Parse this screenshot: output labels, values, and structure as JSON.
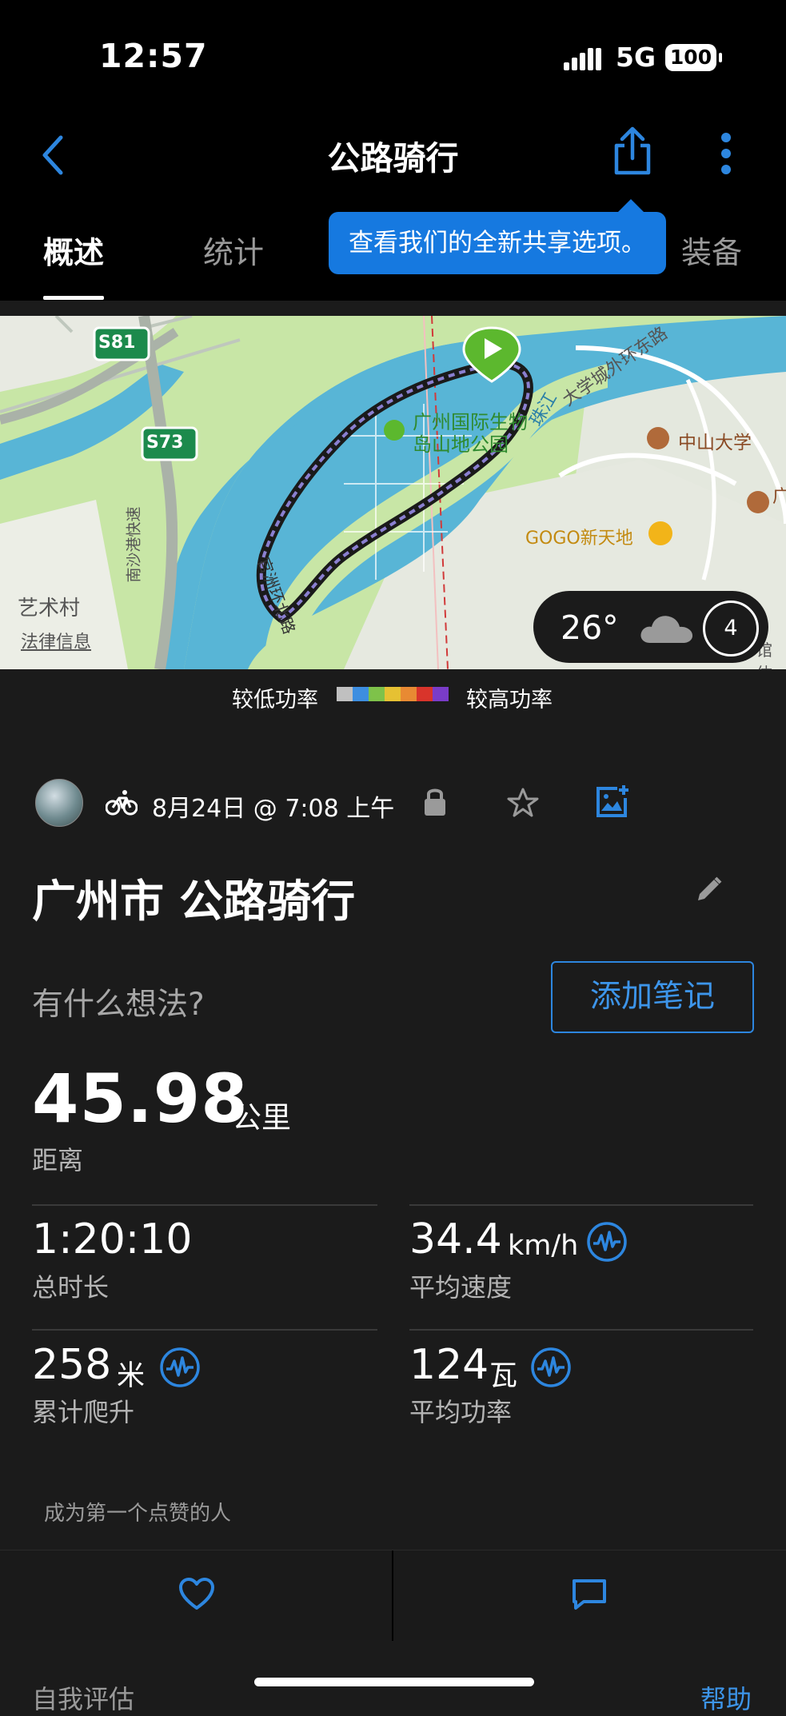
{
  "status_bar": {
    "time": "12:57",
    "network": "5G",
    "battery": "100"
  },
  "header": {
    "title": "公路骑行"
  },
  "tabs": [
    "概述",
    "统计",
    "装备"
  ],
  "tooltip": "查看我们的全新共享选项。",
  "map": {
    "labels": {
      "s81": "S81",
      "s73": "S73",
      "park": "广州国际生物岛山地公园",
      "park_line1": "广州国际生物",
      "park_line2": "岛山地公园",
      "zhujiang": "珠江",
      "univ_road": "大学城外环东路",
      "sysu": "中山大学",
      "gogo": "GOGO新天地",
      "art": "艺术村",
      "legal": "法律信息",
      "nansha": "南沙港快速",
      "ring_road": "官洲环北路",
      "right_edge": "广",
      "bottom_right": "馆体"
    },
    "weather": {
      "temp": "26°",
      "wind": "4"
    }
  },
  "legend": {
    "low": "较低功率",
    "high": "较高功率",
    "colors": [
      "#c0c0c0",
      "#3d8ee0",
      "#7ec24a",
      "#e6c133",
      "#e88a33",
      "#d9342b",
      "#7a3cc8"
    ]
  },
  "activity": {
    "date": "8月24日 @ 7:08 上午",
    "title": "广州市 公路骑行",
    "thought_placeholder": "有什么想法?",
    "add_note": "添加笔记"
  },
  "stats": {
    "distance": {
      "value": "45.98",
      "unit": "公里",
      "label": "距离"
    },
    "duration": {
      "value": "1:20:10",
      "label": "总时长"
    },
    "speed": {
      "value": "34.4",
      "unit": "km/h",
      "label": "平均速度"
    },
    "elevation": {
      "value": "258",
      "unit": "米",
      "label": "累计爬升"
    },
    "power": {
      "value": "124",
      "unit": "瓦",
      "label": "平均功率"
    }
  },
  "like_prompt": "成为第一个点赞的人",
  "bottom": {
    "self_eval": "自我评估",
    "help": "帮助"
  },
  "colors": {
    "accent": "#2d86df",
    "marker": "#5cb82e",
    "water": "#58b5d6",
    "land": "#c8e6a6"
  }
}
